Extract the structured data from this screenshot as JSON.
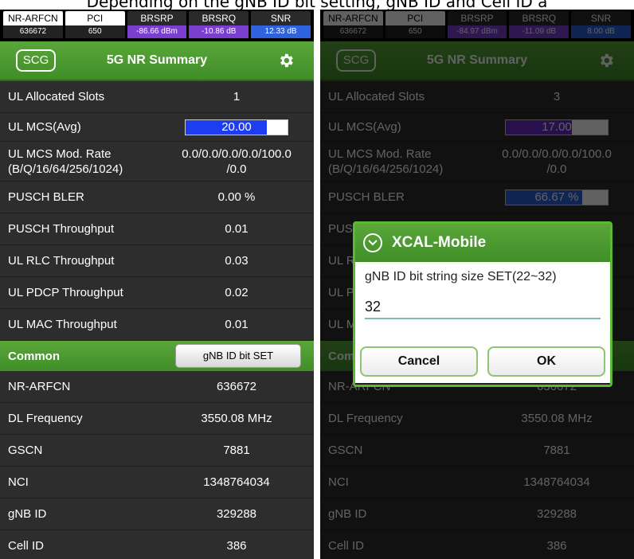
{
  "caption": "Depending on the gNB ID bit setting, gNB ID and Cell ID a",
  "status_labels": [
    "NR-ARFCN",
    "PCI",
    "BRSRP",
    "BRSRQ",
    "SNR"
  ],
  "left": {
    "status_values": [
      "636672",
      "650",
      "-86.66 dBm",
      "-10.86 dB",
      "12.33 dB"
    ],
    "scg_label": "SCG",
    "title": "5G NR Summary",
    "rows": [
      {
        "label": "UL Allocated Slots",
        "value": "1"
      },
      {
        "label": "UL MCS(Avg)",
        "value": "20.00",
        "bar_fraction": 0.8,
        "bar_color": "#1e3cf0"
      },
      {
        "label": "UL MCS Mod. Rate\n(B/Q/16/64/256/1024)",
        "value": "0.0/0.0/0.0/0.0/100.0\n/0.0"
      },
      {
        "label": "PUSCH BLER",
        "value": "0.00 %"
      },
      {
        "label": "PUSCH Throughput",
        "value": "0.01"
      },
      {
        "label": "UL RLC Throughput",
        "value": "0.03"
      },
      {
        "label": "UL PDCP Throughput",
        "value": "0.02"
      },
      {
        "label": "UL MAC Throughput",
        "value": "0.01"
      }
    ],
    "section_label": "Common",
    "gnb_button": "gNB ID bit SET",
    "common_rows": [
      {
        "label": "NR-ARFCN",
        "value": "636672"
      },
      {
        "label": "DL Frequency",
        "value": "3550.08 MHz"
      },
      {
        "label": "GSCN",
        "value": "7881"
      },
      {
        "label": "NCI",
        "value": "1348764034"
      },
      {
        "label": "gNB ID",
        "value": "329288"
      },
      {
        "label": "Cell ID",
        "value": "386"
      }
    ]
  },
  "right": {
    "status_values": [
      "636672",
      "650",
      "-84.97 dBm",
      "-11.09 dB",
      "8.00 dB"
    ],
    "scg_label": "SCG",
    "title": "5G NR Summary",
    "rows": [
      {
        "label": "UL Allocated Slots",
        "value": "3"
      },
      {
        "label": "UL MCS(Avg)",
        "value": "17.00",
        "bar_fraction": 0.65,
        "bar_color": "#6a2cc9"
      },
      {
        "label": "UL MCS Mod. Rate\n(B/Q/16/64/256/1024)",
        "value": "0.0/0.0/0.0/0.0/100.0\n/0.0"
      },
      {
        "label": "PUSCH BLER",
        "value": "66.67 %",
        "bar_fraction": 0.75,
        "bar_color": "#2f63dd"
      },
      {
        "label": "PUSCH Throughput",
        "value": ""
      },
      {
        "label": "UL RLC Throughput",
        "value": ""
      },
      {
        "label": "UL PDCP Throughput",
        "value": ""
      },
      {
        "label": "UL MAC Throughput",
        "value": ""
      }
    ],
    "section_label": "Common",
    "common_rows": [
      {
        "label": "NR-ARFCN",
        "value": "636672"
      },
      {
        "label": "DL Frequency",
        "value": "3550.08 MHz"
      },
      {
        "label": "GSCN",
        "value": "7881"
      },
      {
        "label": "NCI",
        "value": "1348764034"
      },
      {
        "label": "gNB ID",
        "value": "329288"
      },
      {
        "label": "Cell ID",
        "value": "386"
      }
    ]
  },
  "dialog": {
    "title": "XCAL-Mobile",
    "prompt": "gNB ID bit string size SET(22~32)",
    "input_value": "32",
    "cancel_label": "Cancel",
    "ok_label": "OK"
  },
  "colors": {
    "green": "#4a9a2f",
    "background": "#2d2d2d"
  }
}
